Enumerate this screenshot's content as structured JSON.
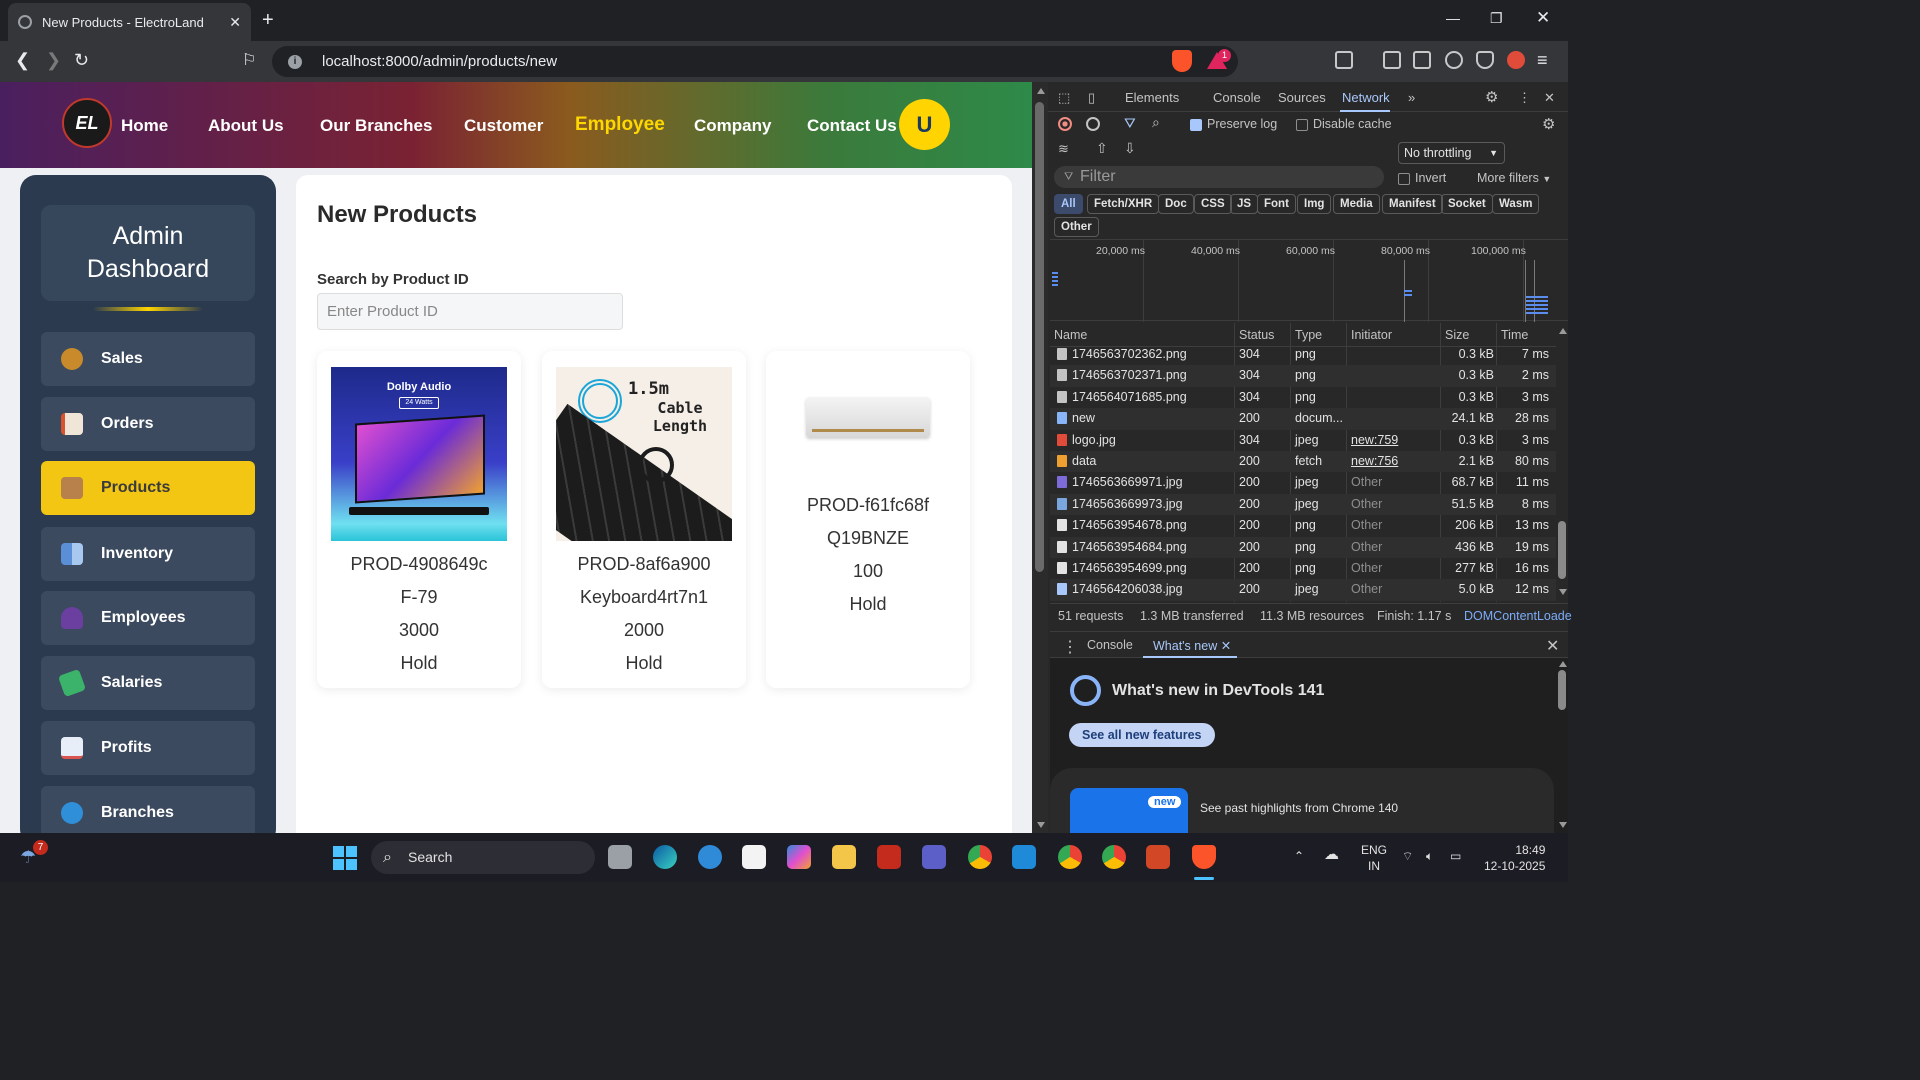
{
  "browser": {
    "tab_title": "New Products - ElectroLand",
    "url": "localhost:8000/admin/products/new",
    "brave_rewards_badge": "1"
  },
  "header": {
    "logo_text": "EL",
    "nav": [
      "Home",
      "About Us",
      "Our Branches",
      "Customer",
      "Employee",
      "Company",
      "Contact Us"
    ],
    "active_nav": "Employee",
    "avatar_letter": "U",
    "accent_color": "#ffd700"
  },
  "sidebar": {
    "title_line1": "Admin",
    "title_line2": "Dashboard",
    "items": [
      {
        "label": "Sales",
        "icon": "money-bag-icon"
      },
      {
        "label": "Orders",
        "icon": "clipboard-icon"
      },
      {
        "label": "Products",
        "icon": "package-icon",
        "active": true
      },
      {
        "label": "Inventory",
        "icon": "inventory-icon"
      },
      {
        "label": "Employees",
        "icon": "people-icon"
      },
      {
        "label": "Salaries",
        "icon": "cash-icon"
      },
      {
        "label": "Profits",
        "icon": "chart-up-icon"
      },
      {
        "label": "Branches",
        "icon": "globe-icon"
      }
    ]
  },
  "main": {
    "title": "New Products",
    "search_label": "Search by Product ID",
    "search_placeholder": "Enter Product ID",
    "products": [
      {
        "id": "PROD-4908649c",
        "name": "F-79",
        "price": "3000",
        "status": "Hold",
        "image": "tv-soundbar",
        "image_caption": "Dolby Audio",
        "image_subcaption": "24 Watts"
      },
      {
        "id": "PROD-8af6a900",
        "name": "Keyboard4rt7n1",
        "price": "2000",
        "status": "Hold",
        "image": "keyboard",
        "image_caption": "1.5m",
        "image_subcaption": "Cable Length"
      },
      {
        "id": "PROD-f61fc68f",
        "name": "Q19BNZE",
        "price": "100",
        "status": "Hold",
        "image": "air-conditioner"
      }
    ]
  },
  "devtools": {
    "tabs": [
      "Elements",
      "Console",
      "Sources",
      "Network"
    ],
    "active_tab": "Network",
    "preserve_log": "Preserve log",
    "disable_cache": "Disable cache",
    "throttling": "No throttling",
    "filter_placeholder": "Filter",
    "invert": "Invert",
    "more_filters": "More filters",
    "type_filters": [
      "All",
      "Fetch/XHR",
      "Doc",
      "CSS",
      "JS",
      "Font",
      "Img",
      "Media",
      "Manifest",
      "Socket",
      "Wasm",
      "Other"
    ],
    "timeline_labels": [
      "20,000 ms",
      "40,000 ms",
      "60,000 ms",
      "80,000 ms",
      "100,000 ms"
    ],
    "columns": [
      "Name",
      "Status",
      "Type",
      "Initiator",
      "Size",
      "Time"
    ],
    "rows": [
      {
        "name": "1746563702362.png",
        "status": "304",
        "type": "png",
        "initiator": "",
        "size": "0.3 kB",
        "time": "7 ms"
      },
      {
        "name": "1746563702371.png",
        "status": "304",
        "type": "png",
        "initiator": "",
        "size": "0.3 kB",
        "time": "2 ms"
      },
      {
        "name": "1746564071685.png",
        "status": "304",
        "type": "png",
        "initiator": "",
        "size": "0.3 kB",
        "time": "3 ms"
      },
      {
        "name": "new",
        "status": "200",
        "type": "docum...",
        "initiator": "",
        "size": "24.1 kB",
        "time": "28 ms"
      },
      {
        "name": "logo.jpg",
        "status": "304",
        "type": "jpeg",
        "initiator": "new:759",
        "size": "0.3 kB",
        "time": "3 ms"
      },
      {
        "name": "data",
        "status": "200",
        "type": "fetch",
        "initiator": "new:756",
        "size": "2.1 kB",
        "time": "80 ms"
      },
      {
        "name": "1746563669971.jpg",
        "status": "200",
        "type": "jpeg",
        "initiator": "Other",
        "size": "68.7 kB",
        "time": "11 ms"
      },
      {
        "name": "1746563669973.jpg",
        "status": "200",
        "type": "jpeg",
        "initiator": "Other",
        "size": "51.5 kB",
        "time": "8 ms"
      },
      {
        "name": "1746563954678.png",
        "status": "200",
        "type": "png",
        "initiator": "Other",
        "size": "206 kB",
        "time": "13 ms"
      },
      {
        "name": "1746563954684.png",
        "status": "200",
        "type": "png",
        "initiator": "Other",
        "size": "436 kB",
        "time": "19 ms"
      },
      {
        "name": "1746563954699.png",
        "status": "200",
        "type": "png",
        "initiator": "Other",
        "size": "277 kB",
        "time": "16 ms"
      },
      {
        "name": "1746564206038.jpg",
        "status": "200",
        "type": "jpeg",
        "initiator": "Other",
        "size": "5.0 kB",
        "time": "12 ms"
      }
    ],
    "status_bar": {
      "requests": "51 requests",
      "transferred": "1.3 MB transferred",
      "resources": "11.3 MB resources",
      "finish": "Finish: 1.17 s",
      "domcontent": "DOMContentLoade"
    },
    "drawer_tabs": [
      "Console",
      "What's new"
    ],
    "whats_new_title": "What's new in DevTools 141",
    "see_all_button": "See all new features",
    "highlights_badge": "new",
    "highlights_text": "See past highlights from Chrome 140"
  },
  "taskbar": {
    "search_label": "Search",
    "notification_count": "7",
    "lang_line1": "ENG",
    "lang_line2": "IN",
    "time": "18:49",
    "date": "12-10-2025"
  }
}
